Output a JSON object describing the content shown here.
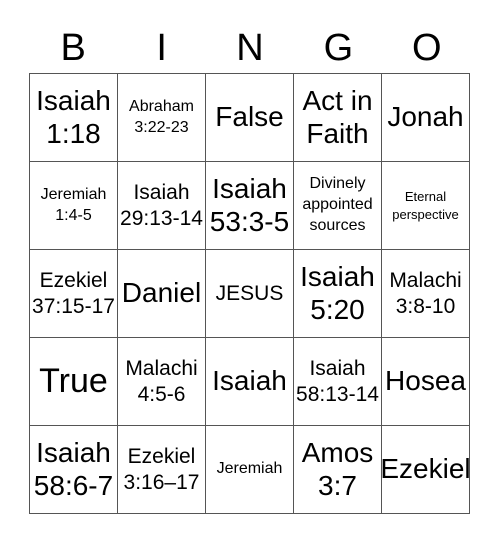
{
  "header": {
    "letters": [
      "B",
      "I",
      "N",
      "G",
      "O"
    ]
  },
  "cells": [
    {
      "text": "Isaiah 1:18",
      "size": "l"
    },
    {
      "text": "Abraham 3:22-23",
      "size": "s"
    },
    {
      "text": "False",
      "size": "l"
    },
    {
      "text": "Act in Faith",
      "size": "l"
    },
    {
      "text": "Jonah",
      "size": "l"
    },
    {
      "text": "Jeremiah 1:4-5",
      "size": "s"
    },
    {
      "text": "Isaiah 29:13-14",
      "size": "m"
    },
    {
      "text": "Isaiah 53:3-5",
      "size": "l"
    },
    {
      "text": "Divinely appointed sources",
      "size": "s"
    },
    {
      "text": "Eternal perspective",
      "size": "xs"
    },
    {
      "text": "Ezekiel 37:15-17",
      "size": "m"
    },
    {
      "text": "Daniel",
      "size": "l"
    },
    {
      "text": "JESUS",
      "size": "m"
    },
    {
      "text": "Isaiah 5:20",
      "size": "l"
    },
    {
      "text": "Malachi 3:8-10",
      "size": "m"
    },
    {
      "text": "True",
      "size": "xl"
    },
    {
      "text": "Malachi 4:5-6",
      "size": "m"
    },
    {
      "text": "Isaiah",
      "size": "l"
    },
    {
      "text": "Isaiah 58:13-14",
      "size": "m"
    },
    {
      "text": "Hosea",
      "size": "l"
    },
    {
      "text": "Isaiah 58:6-7",
      "size": "l"
    },
    {
      "text": "Ezekiel 3:16–17",
      "size": "m"
    },
    {
      "text": "Jeremiah",
      "size": "s"
    },
    {
      "text": "Amos 3:7",
      "size": "l"
    },
    {
      "text": "Ezekiel",
      "size": "l"
    }
  ]
}
